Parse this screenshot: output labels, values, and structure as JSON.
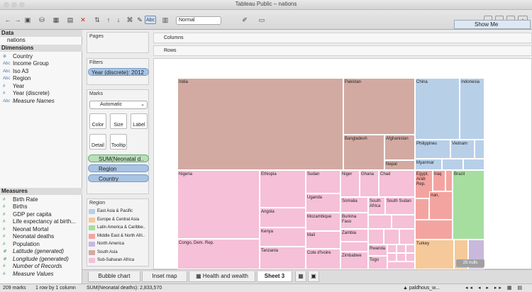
{
  "window": {
    "title": "Tableau Public – nations"
  },
  "toolbar": {
    "fit_select": "Normal",
    "show_me": "Show Me",
    "abc_label": "Abc"
  },
  "data_pane": {
    "header": "Data",
    "datasource": "nations",
    "dimensions_header": "Dimensions",
    "dimensions": [
      "Country",
      "Income Group",
      "Iso A3",
      "Region",
      "Year",
      "Year (discrete)",
      "Measure Names"
    ],
    "measures_header": "Measures",
    "measures": [
      "Birth Rate",
      "Births",
      "GDP per capita",
      "Life expectancy at birth...",
      "Neonat Mortal",
      "Neonatal deaths",
      "Population",
      "Latitude (generated)",
      "Longitude (generated)",
      "Number of Records",
      "Measure Values"
    ]
  },
  "pages": {
    "header": "Pages"
  },
  "filters": {
    "header": "Filters",
    "pill": "Year (discrete): 2012"
  },
  "marks": {
    "header": "Marks",
    "type": "Automatic",
    "buttons": [
      "Color",
      "Size",
      "Label",
      "Detail",
      "Tooltip"
    ],
    "pills": [
      "SUM(Neonatal d..",
      "Region",
      "Country"
    ]
  },
  "legend": {
    "header": "Region",
    "items": [
      {
        "label": "East Asia & Pacific",
        "color": "#b8cfe8"
      },
      {
        "label": "Europe & Central Asia",
        "color": "#f5c99a"
      },
      {
        "label": "Latin America & Caribbe..",
        "color": "#a6dea0"
      },
      {
        "label": "Middle East & North Afri..",
        "color": "#f4a4a0"
      },
      {
        "label": "North America",
        "color": "#c8b8dc"
      },
      {
        "label": "South Asia",
        "color": "#d2aaa2"
      },
      {
        "label": "Sub-Saharan Africa",
        "color": "#f5c0d8"
      }
    ]
  },
  "shelves": {
    "columns": "Columns",
    "rows": "Rows"
  },
  "treemap": {
    "cells": [
      "India",
      "Pakistan",
      "Bangladesh",
      "Afghanistan",
      "Nepal",
      "China",
      "Indonesia",
      "Philippines",
      "Vietnam",
      "Myanmar",
      "Nigeria",
      "Ethiopia",
      "Sudan",
      "Niger",
      "Ghana",
      "Chad",
      "Uganda",
      "Somalia",
      "South Africa",
      "South Sudan",
      "Angola",
      "Mozambique",
      "Burkina Faso",
      "Kenya",
      "Zambia",
      "Mali",
      "Congo, Dem. Rep.",
      "Tanzania",
      "Cote d'Ivoire",
      "Zimbabwe",
      "Rwanda",
      "Togo",
      "Egypt, Arab Rep.",
      "Iraq",
      "Brazil",
      "Iran,",
      "Turkey"
    ],
    "nulls": "25 nulls"
  },
  "tabs": [
    "Bubble chart",
    "Inset map",
    "Health and wealth",
    "Sheet 3"
  ],
  "status": {
    "marks": "209 marks",
    "rows_cols": "1 row by 1 column",
    "sum": "SUM(Neonatal deaths): 2,833,570",
    "user": "paldhous_w..."
  }
}
